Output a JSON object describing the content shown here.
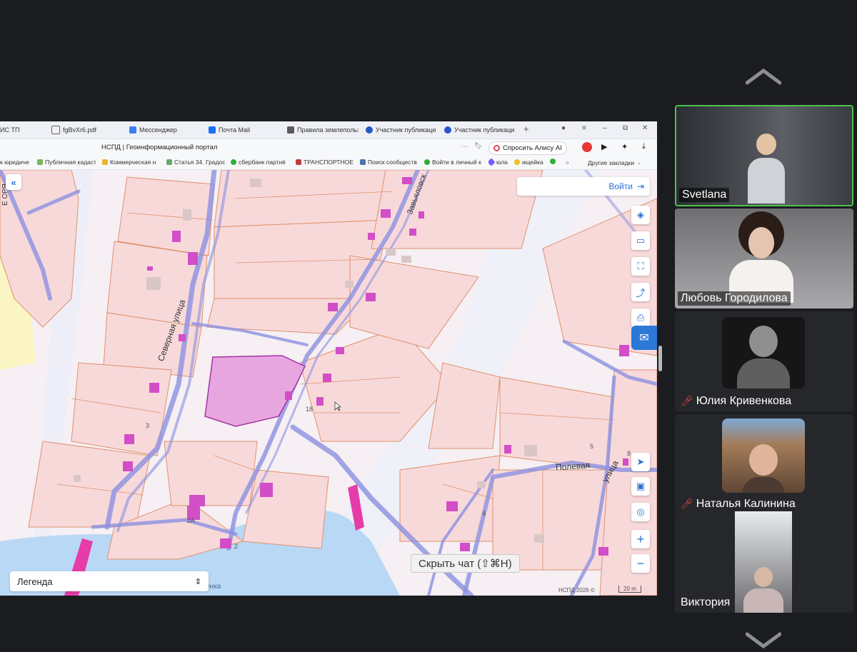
{
  "browser": {
    "tabs": [
      {
        "label": "ИС ТП",
        "icon": "document-icon"
      },
      {
        "label": "fgBvXr6.pdf",
        "icon": "pdf-icon"
      },
      {
        "label": "Мессенджер",
        "icon": "messenger-icon"
      },
      {
        "label": "Почта Mail",
        "icon": "mail-icon"
      },
      {
        "label": "Правила землепольз",
        "icon": "page-icon"
      },
      {
        "label": "Участник публикаци",
        "icon": "globe-icon"
      },
      {
        "label": "Участник публикаци",
        "icon": "globe-icon"
      }
    ],
    "page_title": "НСПД | Геоинформационный портал",
    "ask_alice": "Спросить Алису AI",
    "bookmarks": [
      "к юридиче",
      "Публичная кадаст",
      "Коммерческая н",
      "Статья 34. Градос",
      "сбербанк партнё",
      "ТРАНСПОРТНОЕ",
      "Поиск сообществ",
      "Войти в личный к",
      "юла",
      "ищейка"
    ],
    "other_bookmarks": "Другие закладки"
  },
  "map": {
    "login_button": "Войти",
    "legend_label": "Легенда",
    "streets": {
      "severnaya": "Северная улица",
      "polevaya": "Полевая",
      "ulitsa": "улица",
      "zavyalovskaya": "Завьяловск",
      "top_left": "Е ОРЯ",
      "river": "енка"
    },
    "house_numbers": [
      "2А",
      "2",
      "3",
      "5",
      "4",
      "8",
      "18"
    ],
    "attribution": "НСПД 2026 ©",
    "scale": "20 m",
    "hide_chat_tooltip": "Скрыть чат (⇧⌘H)",
    "colors": {
      "parcel_fill": "#f7d8d9",
      "parcel_line": "#e0906a",
      "road": "#8b90e0",
      "selected": "#e8a6e0",
      "water": "#b7d8f4",
      "building": "#d24ec7"
    }
  },
  "participants": [
    {
      "name": "Svetlana",
      "muted": false,
      "speaking": true
    },
    {
      "name": "Любовь Городилова",
      "muted": false,
      "speaking": false
    },
    {
      "name": "Юлия Кривенкова",
      "muted": true,
      "speaking": false
    },
    {
      "name": "Наталья Калинина",
      "muted": true,
      "speaking": false
    },
    {
      "name": "Виктория",
      "muted": false,
      "speaking": false
    }
  ]
}
